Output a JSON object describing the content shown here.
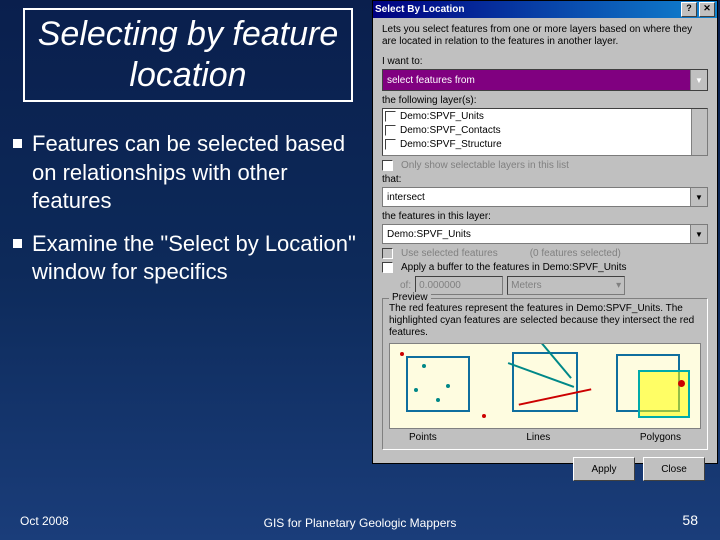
{
  "slide": {
    "title": "Selecting by feature location",
    "bullets": [
      "Features can be selected based on relationships with other features",
      "Examine the \"Select by Location\" window for specifics"
    ],
    "footer_left": "Oct 2008",
    "footer_center": "GIS for Planetary Geologic Mappers",
    "page_num": "58"
  },
  "dialog": {
    "title": "Select By Location",
    "desc": "Lets you select features from one or more layers based on where they are located in relation to the features in another layer.",
    "lbl_want": "I want to:",
    "sel_want": "select features from",
    "lbl_layers": "the following layer(s):",
    "layer_items": [
      "Demo:SPVF_Units",
      "Demo:SPVF_Contacts",
      "Demo:SPVF_Structure"
    ],
    "only_selectable": "Only show selectable layers in this list",
    "lbl_that": "that:",
    "sel_that": "intersect",
    "lbl_in_layer": "the features in this layer:",
    "sel_in_layer": "Demo:SPVF_Units",
    "use_selected": "Use selected features",
    "features_selected": "(0 features selected)",
    "apply_buffer": "Apply a buffer to the features in Demo:SPVF_Units",
    "of": "of:",
    "buf_val": "0.000000",
    "buf_unit": "Meters",
    "preview": {
      "legend": "Preview",
      "text": "The red features represent the features in Demo:SPVF_Units. The highlighted cyan features are selected because they intersect the red features.",
      "cap_points": "Points",
      "cap_lines": "Lines",
      "cap_poly": "Polygons"
    },
    "btn_apply": "Apply",
    "btn_close": "Close"
  }
}
